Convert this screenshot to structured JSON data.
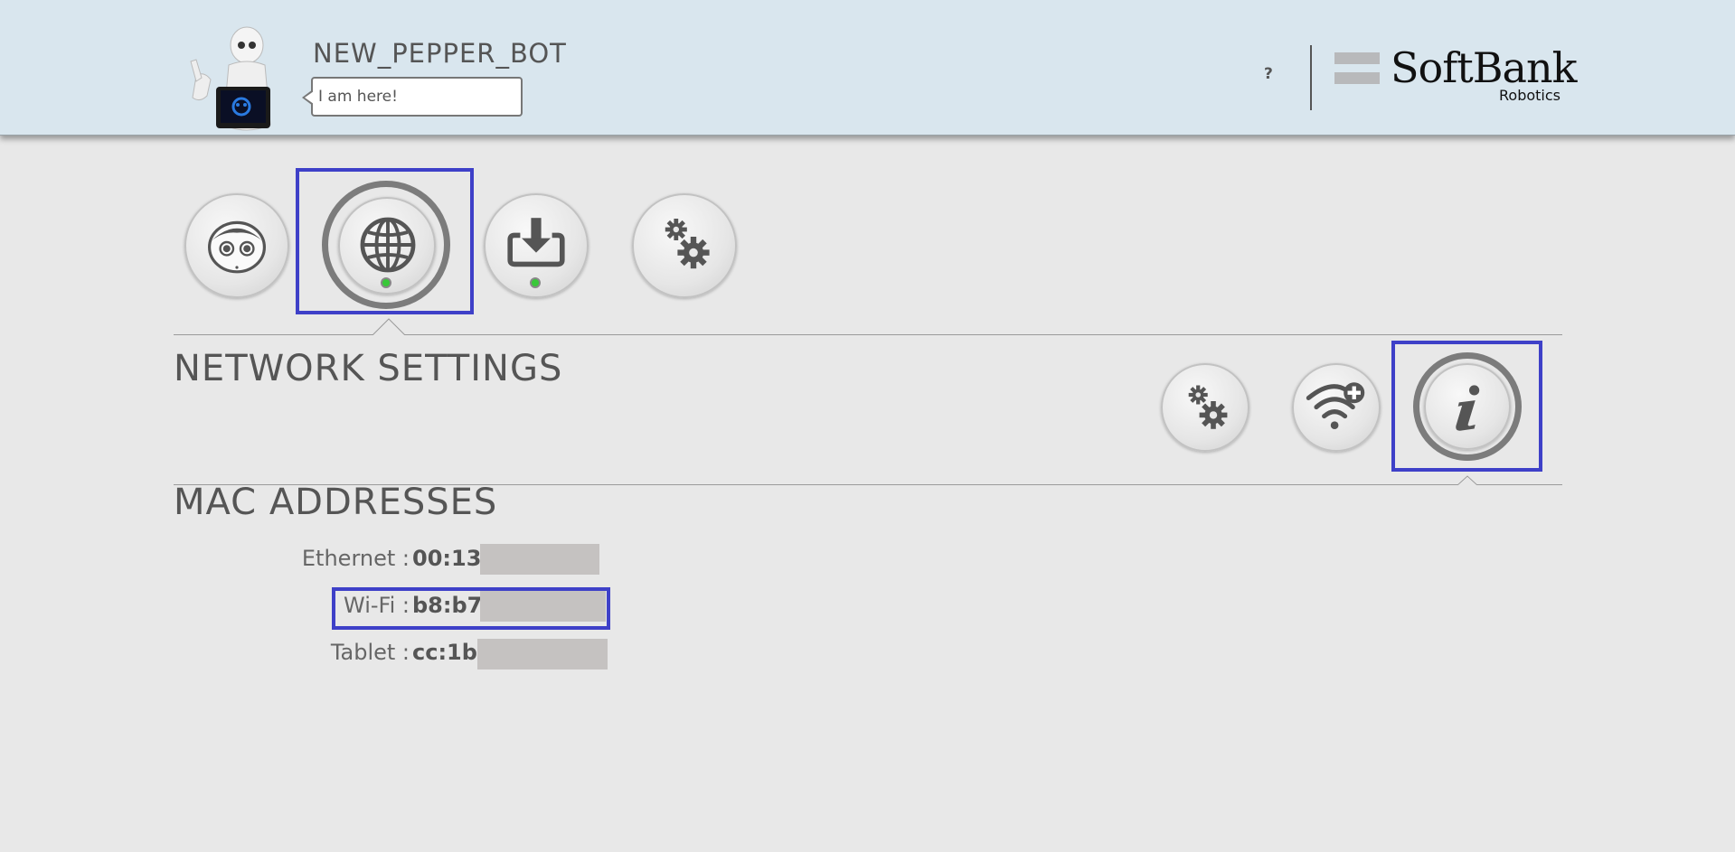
{
  "header": {
    "robot_name": "NEW_PEPPER_BOT",
    "speech": "I am here!",
    "help_label": "?",
    "logo_text": "SoftBank",
    "logo_subtext": "Robotics"
  },
  "top_nav": [
    {
      "icon": "robot-face-icon",
      "selected": false,
      "status_led": false
    },
    {
      "icon": "globe-icon",
      "selected": true,
      "status_led": true
    },
    {
      "icon": "download-icon",
      "selected": false,
      "status_led": true
    },
    {
      "icon": "gears-icon",
      "selected": false,
      "status_led": false
    }
  ],
  "network_settings": {
    "title": "NETWORK SETTINGS",
    "sub_nav": [
      {
        "icon": "gears-icon",
        "selected": false
      },
      {
        "icon": "wifi-add-icon",
        "selected": false
      },
      {
        "icon": "info-icon",
        "selected": true
      }
    ]
  },
  "mac_addresses": {
    "title": "MAC ADDRESSES",
    "rows": [
      {
        "label": "Ethernet :",
        "value": "00:13:"
      },
      {
        "label": "Wi-Fi :",
        "value": "b8:b7:"
      },
      {
        "label": "Tablet :",
        "value": "cc:1b:"
      }
    ]
  },
  "colors": {
    "header_bg": "#d9e6ee",
    "page_bg": "#e8e8e8",
    "highlight": "#3e40c8",
    "led_green": "#38c838"
  }
}
